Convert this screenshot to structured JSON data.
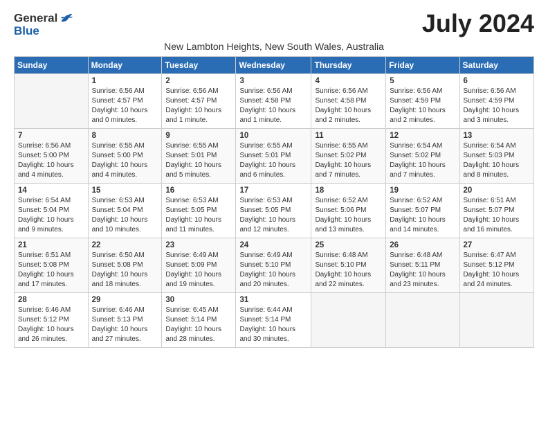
{
  "logo": {
    "general": "General",
    "blue": "Blue"
  },
  "title": "July 2024",
  "subtitle": "New Lambton Heights, New South Wales, Australia",
  "days_of_week": [
    "Sunday",
    "Monday",
    "Tuesday",
    "Wednesday",
    "Thursday",
    "Friday",
    "Saturday"
  ],
  "weeks": [
    [
      {
        "num": "",
        "info": ""
      },
      {
        "num": "1",
        "info": "Sunrise: 6:56 AM\nSunset: 4:57 PM\nDaylight: 10 hours\nand 0 minutes."
      },
      {
        "num": "2",
        "info": "Sunrise: 6:56 AM\nSunset: 4:57 PM\nDaylight: 10 hours\nand 1 minute."
      },
      {
        "num": "3",
        "info": "Sunrise: 6:56 AM\nSunset: 4:58 PM\nDaylight: 10 hours\nand 1 minute."
      },
      {
        "num": "4",
        "info": "Sunrise: 6:56 AM\nSunset: 4:58 PM\nDaylight: 10 hours\nand 2 minutes."
      },
      {
        "num": "5",
        "info": "Sunrise: 6:56 AM\nSunset: 4:59 PM\nDaylight: 10 hours\nand 2 minutes."
      },
      {
        "num": "6",
        "info": "Sunrise: 6:56 AM\nSunset: 4:59 PM\nDaylight: 10 hours\nand 3 minutes."
      }
    ],
    [
      {
        "num": "7",
        "info": "Sunrise: 6:56 AM\nSunset: 5:00 PM\nDaylight: 10 hours\nand 4 minutes."
      },
      {
        "num": "8",
        "info": "Sunrise: 6:55 AM\nSunset: 5:00 PM\nDaylight: 10 hours\nand 4 minutes."
      },
      {
        "num": "9",
        "info": "Sunrise: 6:55 AM\nSunset: 5:01 PM\nDaylight: 10 hours\nand 5 minutes."
      },
      {
        "num": "10",
        "info": "Sunrise: 6:55 AM\nSunset: 5:01 PM\nDaylight: 10 hours\nand 6 minutes."
      },
      {
        "num": "11",
        "info": "Sunrise: 6:55 AM\nSunset: 5:02 PM\nDaylight: 10 hours\nand 7 minutes."
      },
      {
        "num": "12",
        "info": "Sunrise: 6:54 AM\nSunset: 5:02 PM\nDaylight: 10 hours\nand 7 minutes."
      },
      {
        "num": "13",
        "info": "Sunrise: 6:54 AM\nSunset: 5:03 PM\nDaylight: 10 hours\nand 8 minutes."
      }
    ],
    [
      {
        "num": "14",
        "info": "Sunrise: 6:54 AM\nSunset: 5:04 PM\nDaylight: 10 hours\nand 9 minutes."
      },
      {
        "num": "15",
        "info": "Sunrise: 6:53 AM\nSunset: 5:04 PM\nDaylight: 10 hours\nand 10 minutes."
      },
      {
        "num": "16",
        "info": "Sunrise: 6:53 AM\nSunset: 5:05 PM\nDaylight: 10 hours\nand 11 minutes."
      },
      {
        "num": "17",
        "info": "Sunrise: 6:53 AM\nSunset: 5:05 PM\nDaylight: 10 hours\nand 12 minutes."
      },
      {
        "num": "18",
        "info": "Sunrise: 6:52 AM\nSunset: 5:06 PM\nDaylight: 10 hours\nand 13 minutes."
      },
      {
        "num": "19",
        "info": "Sunrise: 6:52 AM\nSunset: 5:07 PM\nDaylight: 10 hours\nand 14 minutes."
      },
      {
        "num": "20",
        "info": "Sunrise: 6:51 AM\nSunset: 5:07 PM\nDaylight: 10 hours\nand 16 minutes."
      }
    ],
    [
      {
        "num": "21",
        "info": "Sunrise: 6:51 AM\nSunset: 5:08 PM\nDaylight: 10 hours\nand 17 minutes."
      },
      {
        "num": "22",
        "info": "Sunrise: 6:50 AM\nSunset: 5:08 PM\nDaylight: 10 hours\nand 18 minutes."
      },
      {
        "num": "23",
        "info": "Sunrise: 6:49 AM\nSunset: 5:09 PM\nDaylight: 10 hours\nand 19 minutes."
      },
      {
        "num": "24",
        "info": "Sunrise: 6:49 AM\nSunset: 5:10 PM\nDaylight: 10 hours\nand 20 minutes."
      },
      {
        "num": "25",
        "info": "Sunrise: 6:48 AM\nSunset: 5:10 PM\nDaylight: 10 hours\nand 22 minutes."
      },
      {
        "num": "26",
        "info": "Sunrise: 6:48 AM\nSunset: 5:11 PM\nDaylight: 10 hours\nand 23 minutes."
      },
      {
        "num": "27",
        "info": "Sunrise: 6:47 AM\nSunset: 5:12 PM\nDaylight: 10 hours\nand 24 minutes."
      }
    ],
    [
      {
        "num": "28",
        "info": "Sunrise: 6:46 AM\nSunset: 5:12 PM\nDaylight: 10 hours\nand 26 minutes."
      },
      {
        "num": "29",
        "info": "Sunrise: 6:46 AM\nSunset: 5:13 PM\nDaylight: 10 hours\nand 27 minutes."
      },
      {
        "num": "30",
        "info": "Sunrise: 6:45 AM\nSunset: 5:14 PM\nDaylight: 10 hours\nand 28 minutes."
      },
      {
        "num": "31",
        "info": "Sunrise: 6:44 AM\nSunset: 5:14 PM\nDaylight: 10 hours\nand 30 minutes."
      },
      {
        "num": "",
        "info": ""
      },
      {
        "num": "",
        "info": ""
      },
      {
        "num": "",
        "info": ""
      }
    ]
  ]
}
